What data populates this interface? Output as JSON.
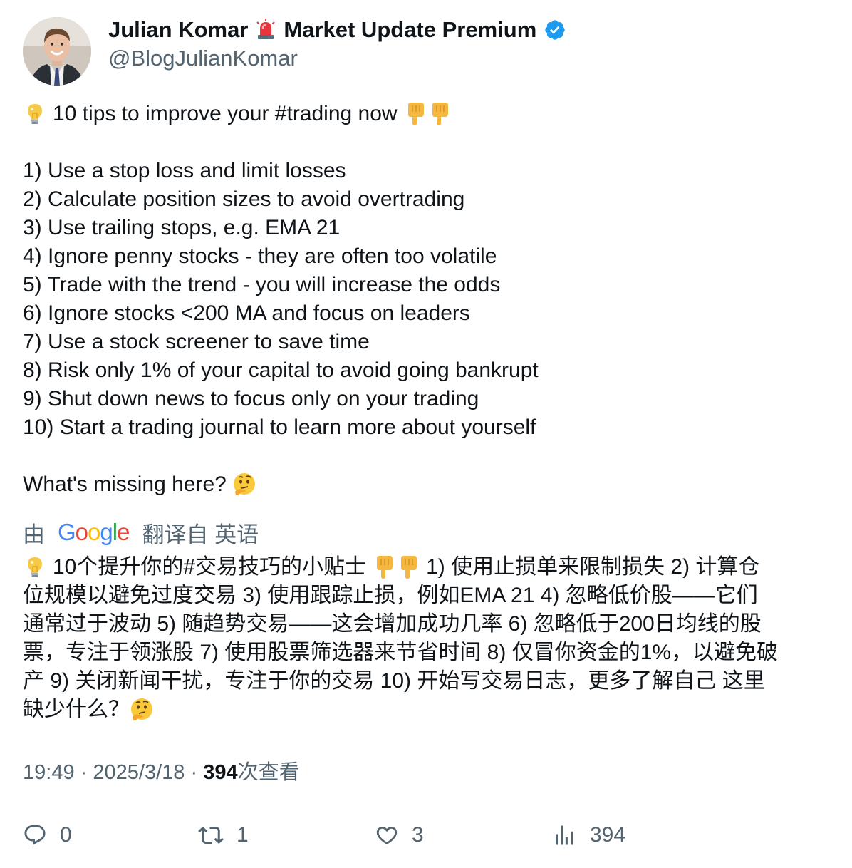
{
  "author": {
    "name": "Julian Komar",
    "name_suffix": "Market Update Premium",
    "handle": "@BlogJulianKomar",
    "verified": true
  },
  "tweet": {
    "headline": "10 tips to improve your #trading now",
    "tips": [
      "1) Use a stop loss and limit losses",
      "2) Calculate position sizes to avoid overtrading",
      "3) Use trailing stops, e.g. EMA 21",
      "4) Ignore penny stocks - they are often too volatile",
      "5) Trade with the trend - you will increase the odds",
      "6) Ignore stocks <200 MA and focus on leaders",
      "7) Use a stock screener to save time",
      "8) Risk only 1% of your capital to avoid going bankrupt",
      "9) Shut down news to focus only on your trading",
      "10) Start a trading journal to learn more about yourself"
    ],
    "closing": "What's missing here?"
  },
  "translation": {
    "by_prefix": "由",
    "provider": "Google",
    "by_suffix": "翻译自 英语",
    "line1_a": "10个提升你的#交易技巧的小贴士",
    "line1_b": "1) 使用止损单来限制损失 2) 计算仓",
    "line2": "位规模以避免过度交易 3) 使用跟踪止损，例如EMA 21 4) 忽略低价股——它们",
    "line3": "通常过于波动 5) 随趋势交易——这会增加成功几率 6) 忽略低于200日均线的股",
    "line4": "票，专注于领涨股 7) 使用股票筛选器来节省时间 8) 仅冒你资金的1%，以避免破",
    "line5": "产 9) 关闭新闻干扰，专注于你的交易 10) 开始写交易日志，更多了解自己 这里",
    "line6": "缺少什么？"
  },
  "meta": {
    "time": "19:49",
    "separator": "·",
    "date": "2025/3/18",
    "views_count": "394",
    "views_label": "次查看"
  },
  "actions": {
    "replies": "0",
    "retweets": "1",
    "likes": "3",
    "views": "394"
  },
  "colors": {
    "text": "#0f1419",
    "secondary": "#536471",
    "verified": "#1d9bf0"
  },
  "icons": {
    "headline_emoji": "light-bulb-icon",
    "pointing_emoji": "backhand-index-pointing-down-icon",
    "thinking_emoji": "thinking-face-icon",
    "siren_emoji": "police-siren-icon"
  }
}
